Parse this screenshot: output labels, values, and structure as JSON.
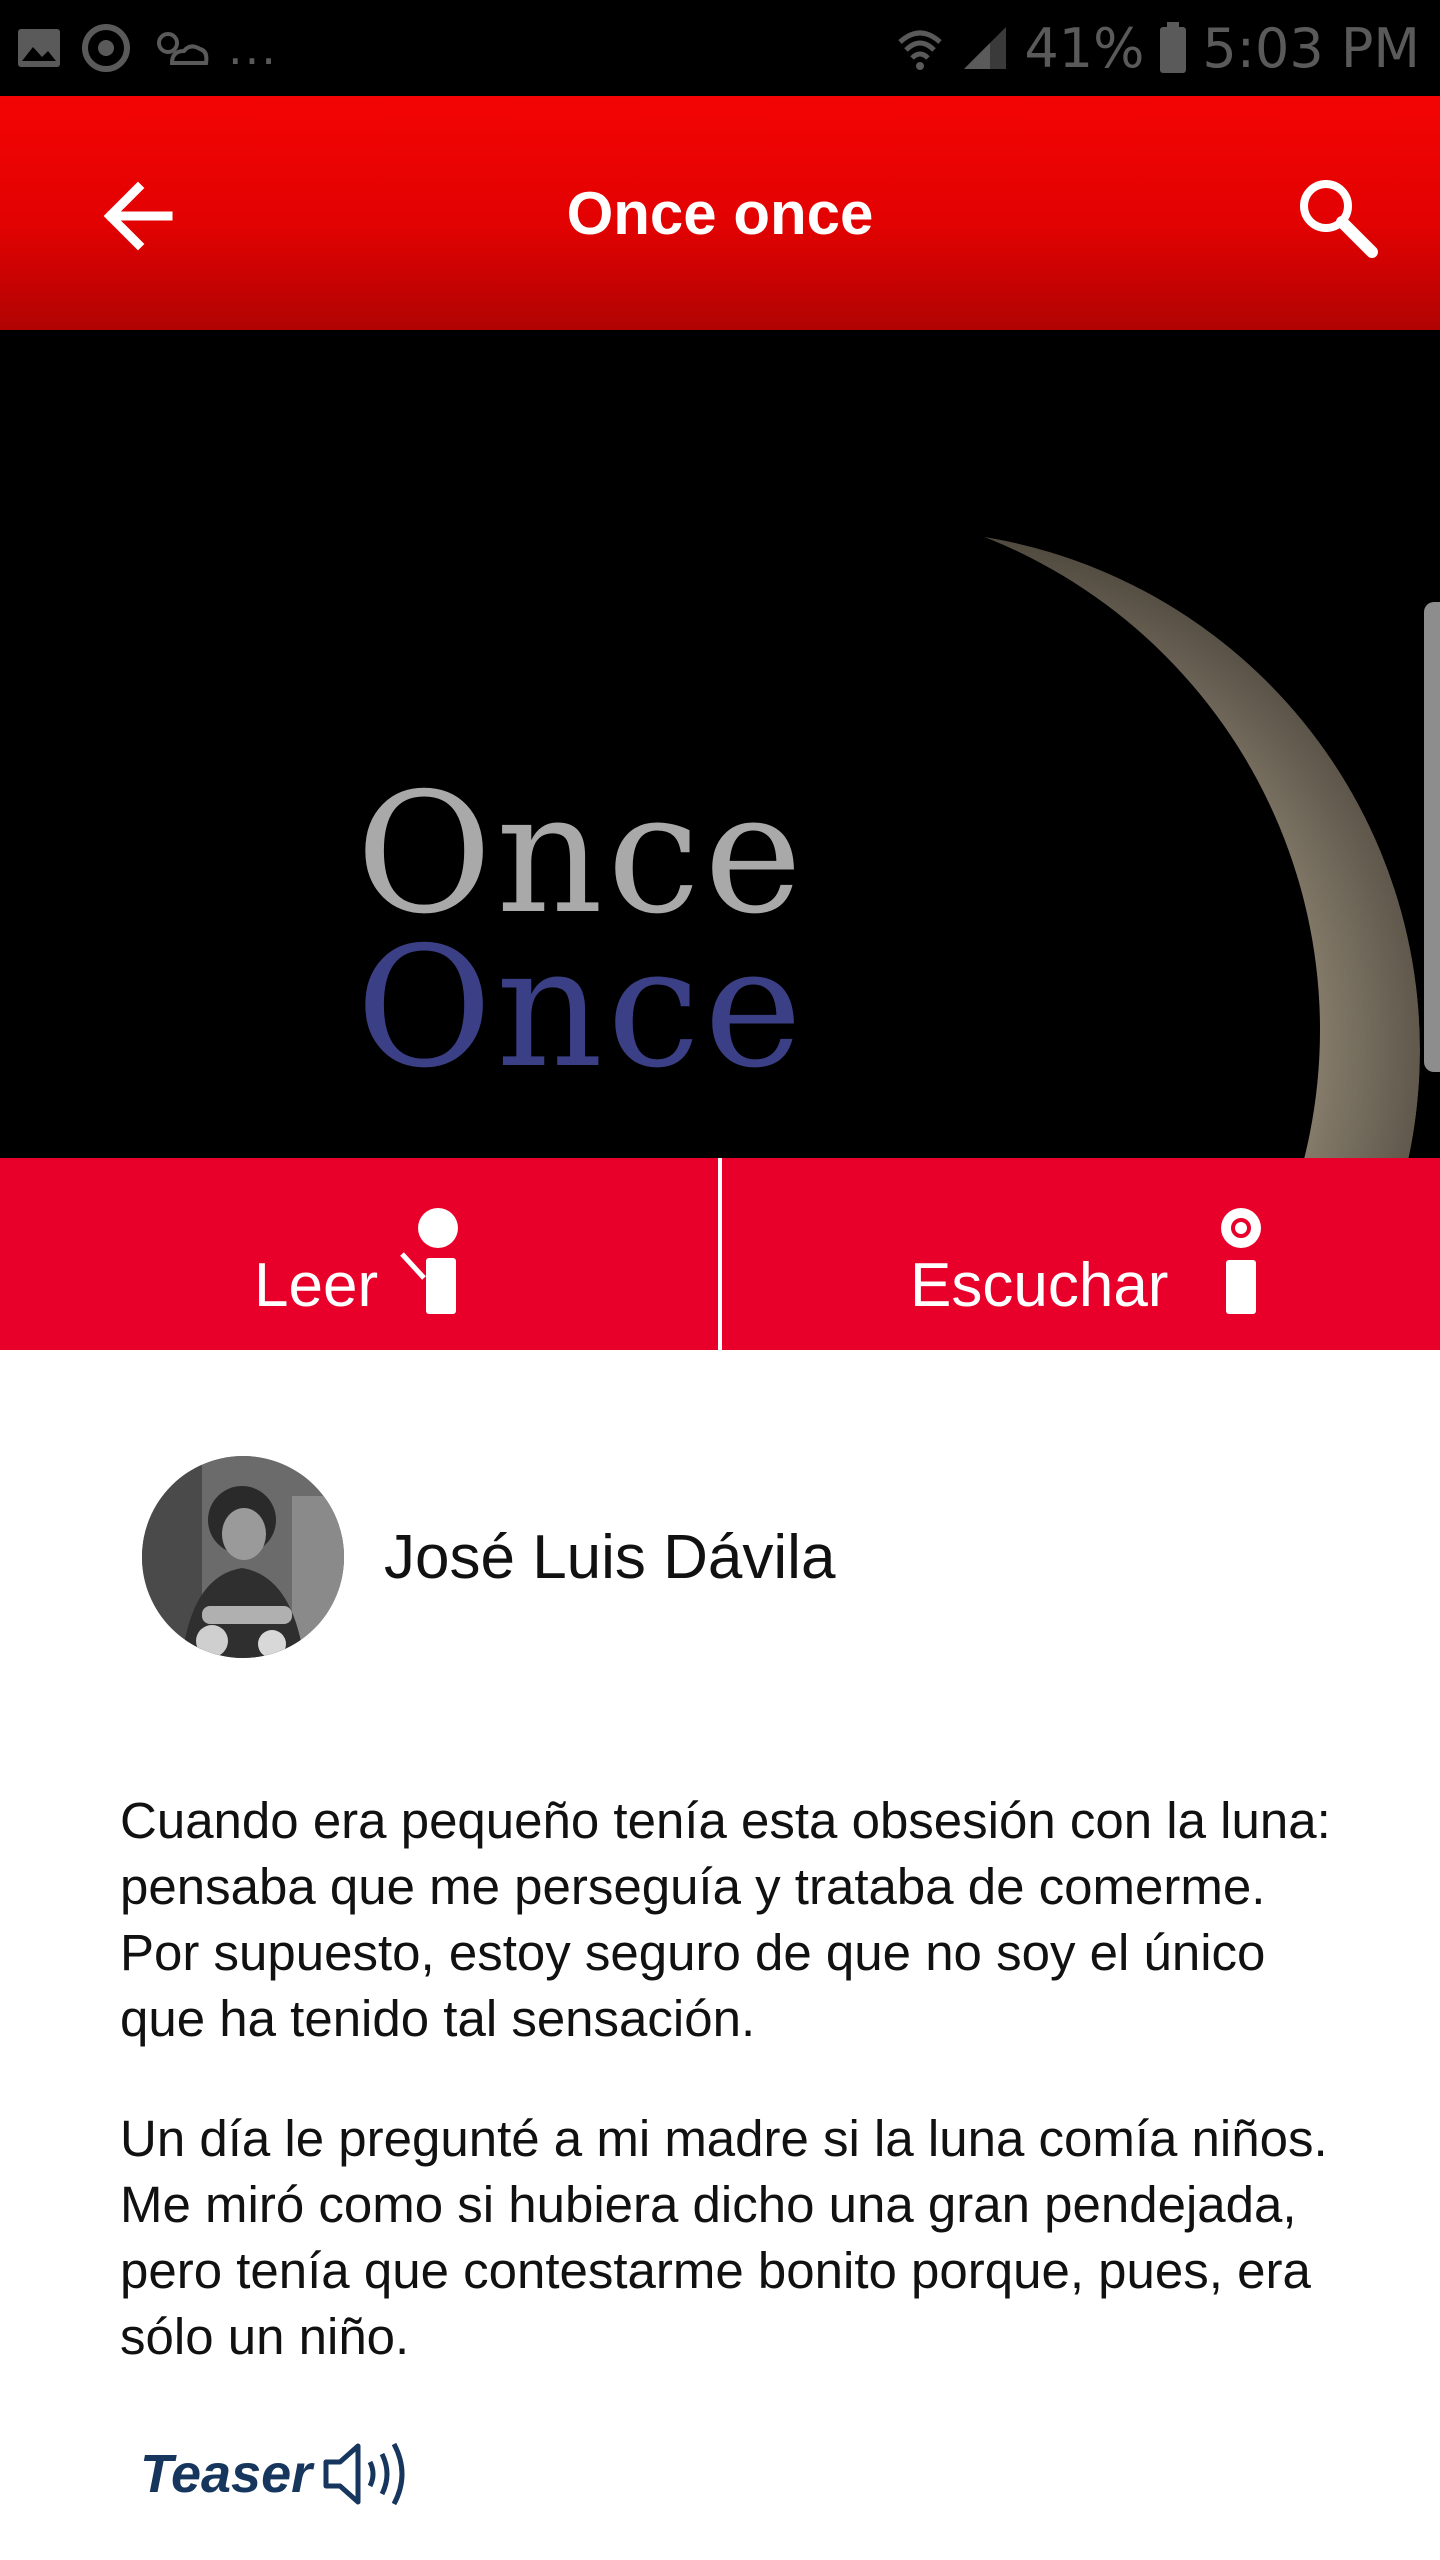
{
  "status_bar": {
    "more": "...",
    "battery": "41%",
    "time": "5:03 PM"
  },
  "app_bar": {
    "title": "Once once",
    "back_icon": "arrow-left-icon",
    "search_icon": "search-icon"
  },
  "hero": {
    "line1": "Once",
    "line2": "Once",
    "colors": {
      "line1": "#a9a9a9",
      "line2": "#3b3f86"
    }
  },
  "actions": {
    "read_label": "Leer",
    "listen_label": "Escuchar",
    "background": "#e8002a"
  },
  "author": {
    "name": "José Luis Dávila"
  },
  "content": {
    "paragraphs": [
      "Cuando era pequeño tenía esta obsesión con la luna: pensaba que me perseguía y trataba de comerme. Por supuesto, estoy seguro de que no soy el único que ha tenido tal sensación.",
      "Un día le pregunté a mi madre si la luna comía niños. Me miró como si hubiera dicho una gran pendejada, pero tenía que contestarme bonito porque, pues, era sólo un niño."
    ]
  },
  "teaser": {
    "label": "Teaser",
    "icon": "speaker-icon"
  }
}
